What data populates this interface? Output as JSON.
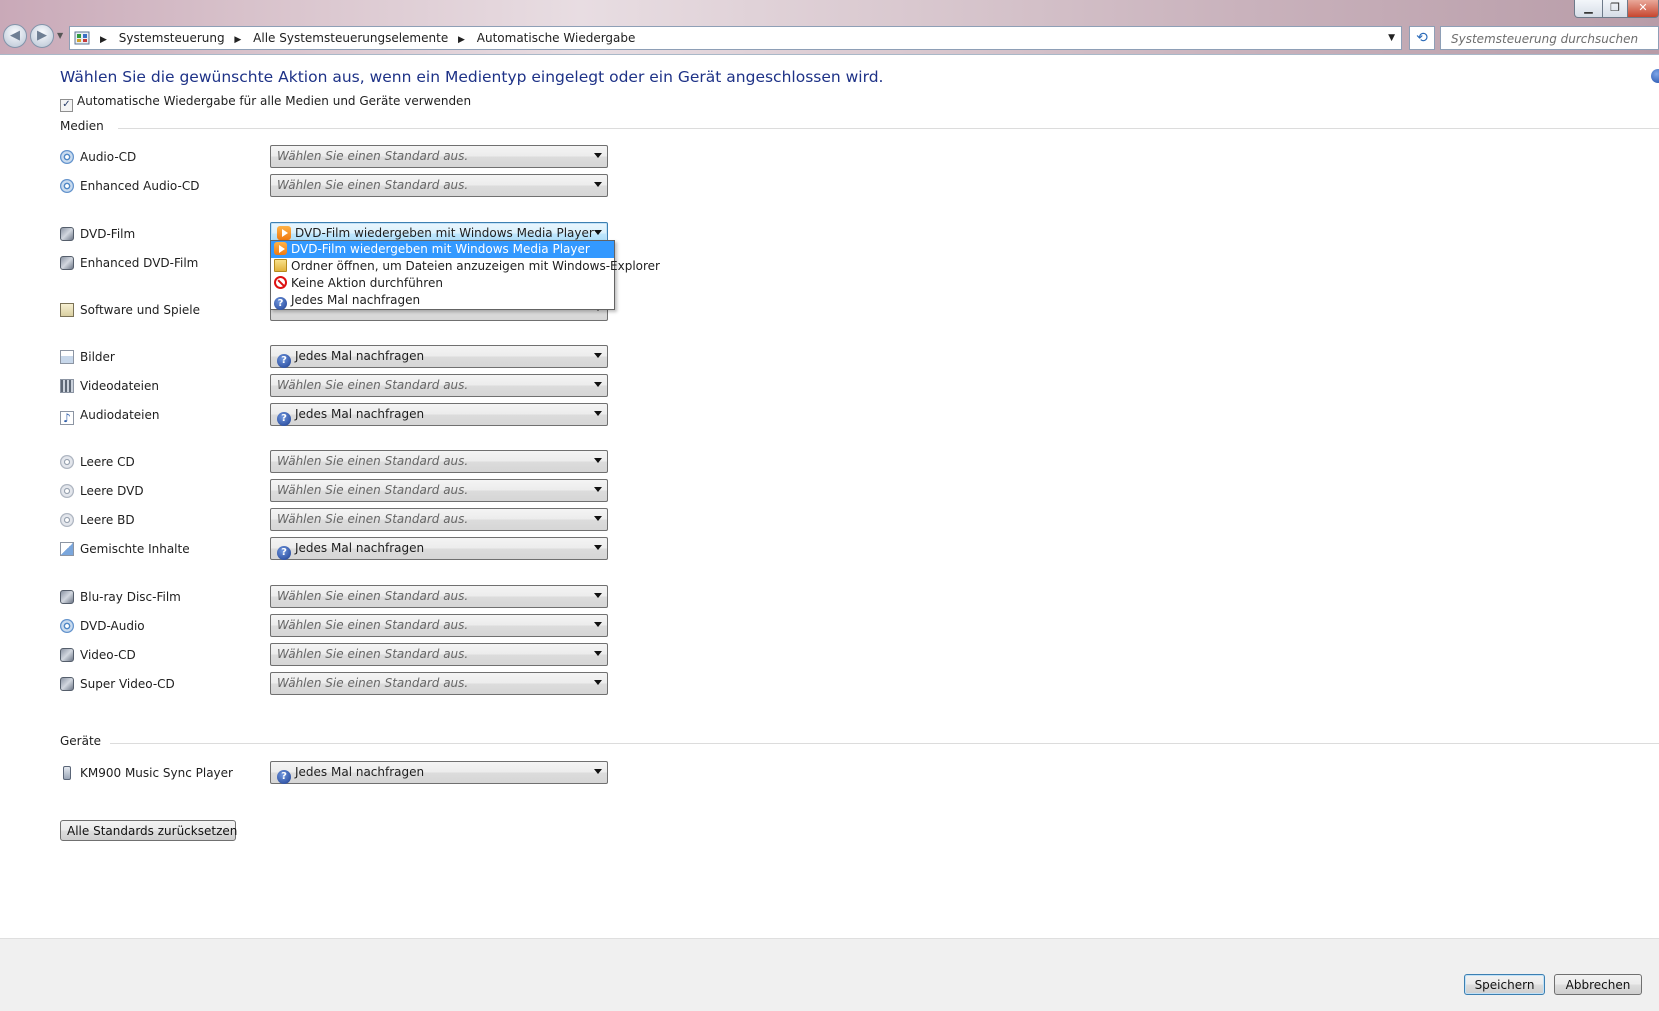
{
  "window": {
    "minimize_glyph": "▁",
    "maximize_glyph": "❐",
    "close_glyph": "✕"
  },
  "address_bar": {
    "breadcrumbs": [
      "Systemsteuerung",
      "Alle Systemsteuerungselemente",
      "Automatische Wiedergabe"
    ],
    "separator_glyph": "▶",
    "dropdown_glyph": "▼",
    "refresh_glyph": "⟲",
    "back_glyph": "◀",
    "forward_glyph": "▶",
    "nav_dropdown_glyph": "▼"
  },
  "search": {
    "placeholder": "Systemsteuerung durchsuchen"
  },
  "heading": "Wählen Sie die gewünschte Aktion aus, wenn ein Medientyp eingelegt oder ein Gerät angeschlossen wird.",
  "master_checkbox": {
    "label": "Automatische Wiedergabe für alle Medien und Geräte verwenden",
    "checked": true,
    "check_glyph": "✓"
  },
  "media_section": {
    "title": "Medien",
    "items": [
      {
        "label": "Audio-CD",
        "icon": "audio-cd-icon",
        "value": "Wählen Sie einen Standard aus.",
        "placeholder": true
      },
      {
        "label": "Enhanced Audio-CD",
        "icon": "enhanced-audio-cd-icon",
        "value": "Wählen Sie einen Standard aus.",
        "placeholder": true
      },
      {
        "label": "DVD-Film",
        "icon": "dvd-film-icon",
        "value": "DVD-Film wiedergeben mit Windows Media Player",
        "option_icon": "windows-media-player-icon",
        "open": true
      },
      {
        "label": "Enhanced DVD-Film",
        "icon": "enhanced-dvd-film-icon",
        "value": "",
        "hidden_by_dropdown": true
      },
      {
        "label": "Software und Spiele",
        "icon": "software-games-icon",
        "value": "",
        "hidden_by_dropdown": true
      },
      {
        "label": "Bilder",
        "icon": "pictures-icon",
        "value": "Jedes Mal nachfragen",
        "option_icon": "question-icon"
      },
      {
        "label": "Videodateien",
        "icon": "video-files-icon",
        "value": "Wählen Sie einen Standard aus.",
        "placeholder": true
      },
      {
        "label": "Audiodateien",
        "icon": "audio-files-icon",
        "value": "Jedes Mal nachfragen",
        "option_icon": "question-icon"
      },
      {
        "label": "Leere CD",
        "icon": "blank-cd-icon",
        "value": "Wählen Sie einen Standard aus.",
        "placeholder": true
      },
      {
        "label": "Leere DVD",
        "icon": "blank-dvd-icon",
        "value": "Wählen Sie einen Standard aus.",
        "placeholder": true
      },
      {
        "label": "Leere BD",
        "icon": "blank-bd-icon",
        "value": "Wählen Sie einen Standard aus.",
        "placeholder": true
      },
      {
        "label": "Gemischte Inhalte",
        "icon": "mixed-content-icon",
        "value": "Jedes Mal nachfragen",
        "option_icon": "question-icon"
      },
      {
        "label": "Blu-ray Disc-Film",
        "icon": "bluray-film-icon",
        "value": "Wählen Sie einen Standard aus.",
        "placeholder": true
      },
      {
        "label": "DVD-Audio",
        "icon": "dvd-audio-icon",
        "value": "Wählen Sie einen Standard aus.",
        "placeholder": true
      },
      {
        "label": "Video-CD",
        "icon": "video-cd-icon",
        "value": "Wählen Sie einen Standard aus.",
        "placeholder": true
      },
      {
        "label": "Super Video-CD",
        "icon": "super-video-cd-icon",
        "value": "Wählen Sie einen Standard aus.",
        "placeholder": true
      }
    ]
  },
  "dvd_dropdown_options": [
    {
      "label": "DVD-Film wiedergeben mit Windows Media Player",
      "icon": "windows-media-player-icon",
      "selected": true
    },
    {
      "label": "Ordner öffnen, um Dateien anzuzeigen mit Windows-Explorer",
      "icon": "folder-icon"
    },
    {
      "label": "Keine Aktion durchführen",
      "icon": "no-action-icon"
    },
    {
      "label": "Jedes Mal nachfragen",
      "icon": "question-icon"
    }
  ],
  "devices_section": {
    "title": "Geräte",
    "items": [
      {
        "label": "KM900 Music Sync Player",
        "icon": "device-icon",
        "value": "Jedes Mal nachfragen",
        "option_icon": "question-icon"
      }
    ]
  },
  "reset_button": "Alle Standards zurücksetzen",
  "footer": {
    "save": "Speichern",
    "cancel": "Abbrechen"
  },
  "question_glyph": "?"
}
